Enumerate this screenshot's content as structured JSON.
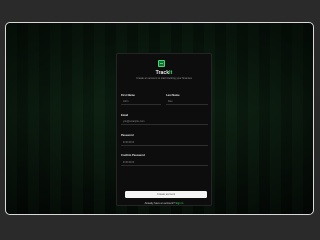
{
  "brand": {
    "name_prefix": "Track",
    "name_accent": "It",
    "tagline": "Create an account to start tracking your finances"
  },
  "form": {
    "first_name": {
      "label": "First Name",
      "value": "John"
    },
    "last_name": {
      "label": "Last Name",
      "value": "Doe"
    },
    "email": {
      "label": "Email",
      "value": "you@example.com"
    },
    "password": {
      "label": "Password",
      "value": "••••••••"
    },
    "confirm_password": {
      "label": "Confirm Password",
      "value": "••••••••"
    },
    "submit_label": "Create account"
  },
  "signin": {
    "prompt": "Already have an account?",
    "link_label": "Sign in"
  },
  "colors": {
    "accent": "#3ddc75",
    "card_bg": "#0d0d0d",
    "button_bg": "#f4f4f4"
  },
  "icons": {
    "logo": "wallet-icon"
  }
}
